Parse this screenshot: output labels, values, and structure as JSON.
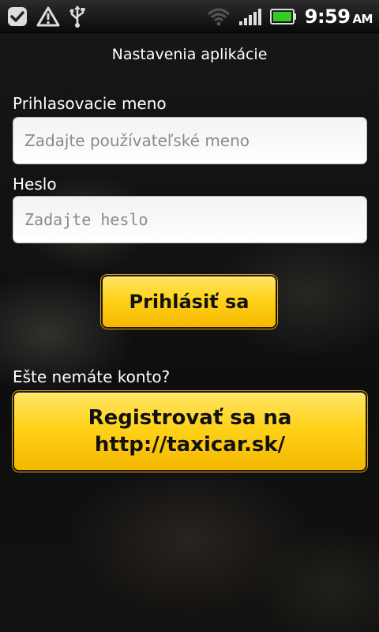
{
  "status_bar": {
    "left_icons": [
      "tasks-check-icon",
      "warning-triangle-icon",
      "usb-icon"
    ],
    "right_icons": [
      "wifi-icon",
      "signal-bars-icon",
      "battery-icon"
    ],
    "time": "9:59",
    "ampm": "AM",
    "battery_color": "#33cc22"
  },
  "title": "Nastavenia aplikácie",
  "username": {
    "label": "Prihlasovacie meno",
    "placeholder": "Zadajte používateľské meno",
    "value": ""
  },
  "password": {
    "label": "Heslo",
    "placeholder": "Zadajte heslo",
    "value": ""
  },
  "login_button": "Prihlásiť sa",
  "no_account_text": "Ešte nemáte konto?",
  "register_button": {
    "line1": "Registrovať sa na",
    "line2": "http://taxicar.sk/"
  },
  "colors": {
    "button_yellow": "#ffd21a",
    "background": "#0b0b0b"
  }
}
